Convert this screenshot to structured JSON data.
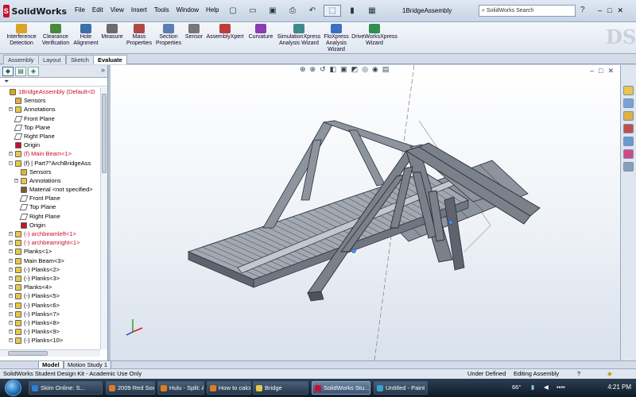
{
  "app": {
    "logo_text": "SolidWorks",
    "logo_mark": "S",
    "document_title": "1BridgeAssembly"
  },
  "menus": [
    "File",
    "Edit",
    "View",
    "Insert",
    "Tools",
    "Window",
    "Help"
  ],
  "search": {
    "placeholder": "SolidWorks Search",
    "icon": "magnifier-icon"
  },
  "help": "?",
  "window_controls": {
    "minimize": "–",
    "restore": "□",
    "close": "✕"
  },
  "ribbon_tools": [
    {
      "label": "Interference\nDetection",
      "color": "#d8a528"
    },
    {
      "label": "Clearance\nVerification",
      "color": "#4b8a3c"
    },
    {
      "label": "Hole\nAlignment",
      "color": "#3c6fa8"
    },
    {
      "label": "Measure",
      "color": "#6b6b6b"
    },
    {
      "label": "Mass\nProperties",
      "color": "#b04848"
    },
    {
      "label": "Section\nProperties",
      "color": "#5a7fb0"
    },
    {
      "label": "Sensor",
      "color": "#777777"
    },
    {
      "label": "AssemblyXpert",
      "color": "#c03c3c"
    },
    {
      "label": "Curvature",
      "color": "#8a3cb0"
    },
    {
      "label": "SimulationXpress\nAnalysis Wizard",
      "color": "#3c8a8a"
    },
    {
      "label": "FloXpress\nAnalysis\nWizard",
      "color": "#3c6fc0"
    },
    {
      "label": "DriveWorksXpress\nWizard",
      "color": "#2f8f4f"
    }
  ],
  "command_tabs": [
    "Assembly",
    "Layout",
    "Sketch",
    "Evaluate"
  ],
  "active_command_tab": "Evaluate",
  "tree": [
    {
      "label": "1BridgeAssembly  (Default<D",
      "red": true,
      "indent": 0,
      "icon": "assembly-icon"
    },
    {
      "label": "Sensors",
      "indent": 1,
      "icon": "sensors-icon"
    },
    {
      "label": "Annotations",
      "indent": 1,
      "icon": "annotations-icon",
      "expander": "+"
    },
    {
      "label": "Front Plane",
      "indent": 1,
      "icon": "plane-icon"
    },
    {
      "label": "Top Plane",
      "indent": 1,
      "icon": "plane-icon"
    },
    {
      "label": "Right Plane",
      "indent": 1,
      "icon": "plane-icon"
    },
    {
      "label": "Origin",
      "indent": 1,
      "icon": "origin-icon"
    },
    {
      "label": "(f) Main Beam<1>",
      "red": true,
      "indent": 1,
      "icon": "part-icon",
      "expander": "+"
    },
    {
      "label": "(f) | Part7^ArchBridgeAss",
      "indent": 1,
      "icon": "part-icon",
      "expander": "-"
    },
    {
      "label": "Sensors",
      "indent": 2,
      "icon": "sensors-icon"
    },
    {
      "label": "Annotations",
      "indent": 2,
      "icon": "annotations-icon",
      "expander": "+"
    },
    {
      "label": "Material <not specified>",
      "indent": 2,
      "icon": "material-icon"
    },
    {
      "label": "Front Plane",
      "indent": 2,
      "icon": "plane-icon"
    },
    {
      "label": "Top Plane",
      "indent": 2,
      "icon": "plane-icon"
    },
    {
      "label": "Right Plane",
      "indent": 2,
      "icon": "plane-icon"
    },
    {
      "label": "Origin",
      "indent": 2,
      "icon": "origin-icon"
    },
    {
      "label": "(-) archbeamleft<1>",
      "red": true,
      "indent": 1,
      "icon": "part-icon",
      "expander": "+"
    },
    {
      "label": "(-) archbeamright<1>",
      "red": true,
      "indent": 1,
      "icon": "part-icon",
      "expander": "+"
    },
    {
      "label": "Planks<1>",
      "indent": 1,
      "icon": "part-icon",
      "expander": "+"
    },
    {
      "label": "Main Beam<3>",
      "indent": 1,
      "icon": "part-icon",
      "expander": "+"
    },
    {
      "label": "(-) Planks<2>",
      "indent": 1,
      "icon": "part-icon",
      "expander": "+"
    },
    {
      "label": "(-) Planks<3>",
      "indent": 1,
      "icon": "part-icon",
      "expander": "+"
    },
    {
      "label": "Planks<4>",
      "indent": 1,
      "icon": "part-icon",
      "expander": "+"
    },
    {
      "label": "(-) Planks<5>",
      "indent": 1,
      "icon": "part-icon",
      "expander": "+"
    },
    {
      "label": "(-) Planks<6>",
      "indent": 1,
      "icon": "part-icon",
      "expander": "+"
    },
    {
      "label": "(-) Planks<7>",
      "indent": 1,
      "icon": "part-icon",
      "expander": "+"
    },
    {
      "label": "(-) Planks<8>",
      "indent": 1,
      "icon": "part-icon",
      "expander": "+"
    },
    {
      "label": "(-) Planks<9>",
      "indent": 1,
      "icon": "part-icon",
      "expander": "+"
    },
    {
      "label": "(-) Planks<10>",
      "indent": 1,
      "icon": "part-icon",
      "expander": "+"
    }
  ],
  "bottom_tabs": [
    "Model",
    "Motion Study 1"
  ],
  "active_bottom_tab": "Model",
  "status": {
    "left": "SolidWorks Student Design Kit - Academic Use Only",
    "state": "Under Defined",
    "mode": "Editing Assembly",
    "help": "?"
  },
  "taskbar": {
    "buttons": [
      {
        "label": "Skim Online: S...",
        "color": "#2f7fd8"
      },
      {
        "label": "2009 Red Sox S...",
        "color": "#e07b22"
      },
      {
        "label": "Hulu - Split: A ...",
        "color": "#e07b22"
      },
      {
        "label": "How to calcula...",
        "color": "#e07b22"
      },
      {
        "label": "Bridge",
        "color": "#e8c84a"
      },
      {
        "label": "SolidWorks Stu...",
        "color": "#c8102e",
        "active": true
      },
      {
        "label": "Untitled - Paint",
        "color": "#3aa0d0"
      }
    ],
    "tray_temp": "66°",
    "clock": "4:21 PM"
  },
  "colors": {
    "model_dark": "#5d6470",
    "model_mid": "#8d949e",
    "model_light": "#b8bec6",
    "model_edge": "#2b2f36"
  }
}
